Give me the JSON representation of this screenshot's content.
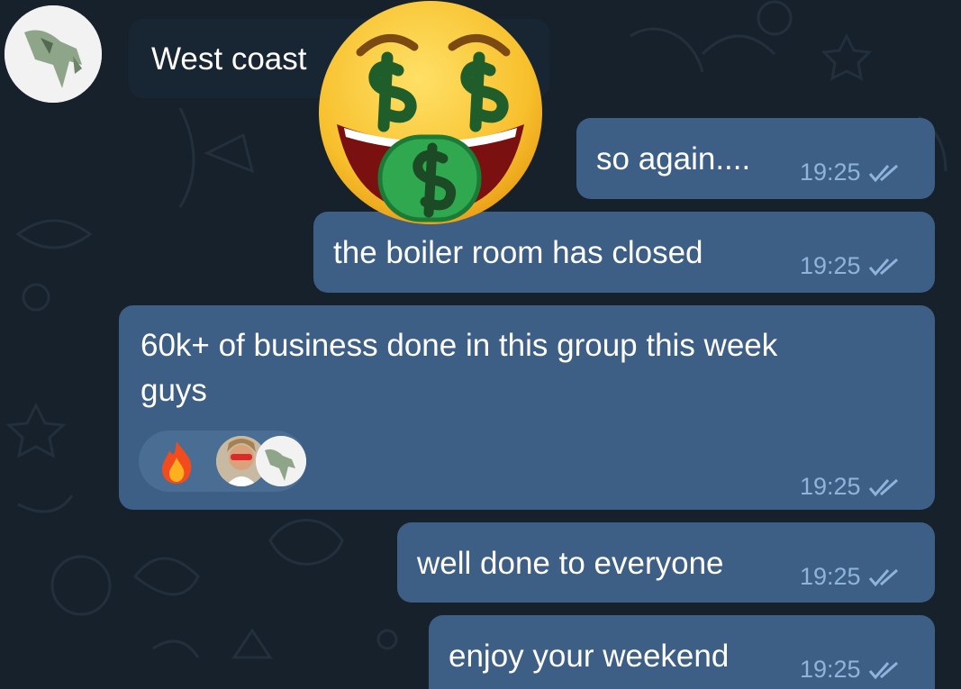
{
  "chat": {
    "incoming": {
      "text": "West coast"
    },
    "messages": [
      {
        "text": "so again....",
        "time": "19:25",
        "status": "read"
      },
      {
        "text": "the boiler room has closed",
        "time": "19:25",
        "status": "read"
      },
      {
        "text_line1": "60k+ of business done in this group this week",
        "text_line2": "guys",
        "time": "19:25",
        "status": "read",
        "reactions": [
          "fire-emoji",
          "user-avatar-glasses",
          "user-avatar-dollar-bird"
        ]
      },
      {
        "text": "well done to everyone",
        "time": "19:25",
        "status": "read"
      },
      {
        "text": "enjoy your weekend",
        "time": "19:25",
        "status": "read"
      }
    ]
  },
  "overlay": {
    "emoji": "money-mouth-face"
  },
  "colors": {
    "background": "#17212b",
    "outgoing_bubble": "#3d5f86",
    "incoming_bubble": "#182533",
    "meta_text": "#8fb4db"
  }
}
